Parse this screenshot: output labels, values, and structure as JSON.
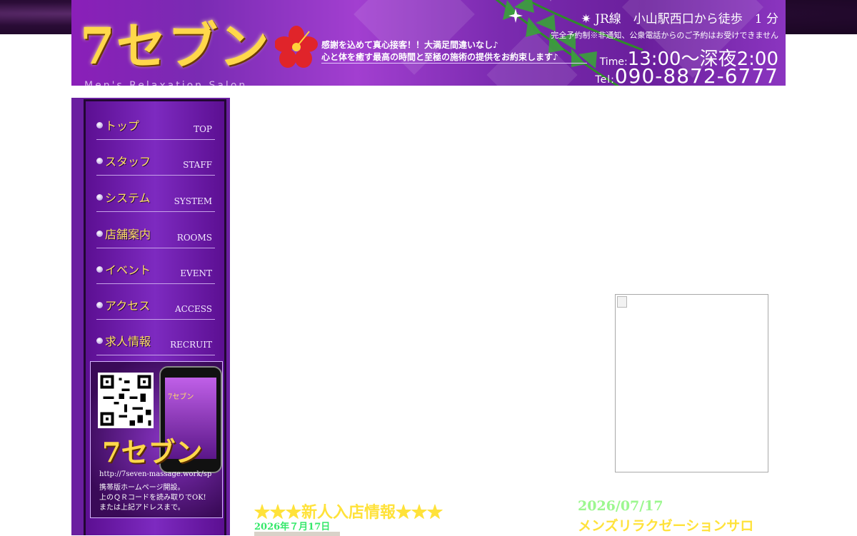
{
  "header": {
    "logo": "7セブン",
    "logo_sub": "Men's Relaxation Salon",
    "tagline1": "感謝を込めて真心接客！！大満足間違いなし♪",
    "tagline2": "心と体を癒す最高の時間と至極の施術の提供をお約束します♪",
    "access": "JR線　小山駅西口から徒歩　1 分",
    "reservation_note": "完全予約制※非通知、公衆電話からのご予約はお受けできません",
    "time_label": "Time:",
    "hours": "13:00～深夜2:00",
    "tel_label": "Tel:",
    "tel": "090-8872-6777"
  },
  "sidebar": {
    "nav": [
      {
        "jp": "トップ",
        "en": "TOP"
      },
      {
        "jp": "スタッフ",
        "en": "STAFF"
      },
      {
        "jp": "システム",
        "en": "SYSTEM"
      },
      {
        "jp": "店舗案内",
        "en": "ROOMS"
      },
      {
        "jp": "イベント",
        "en": "EVENT"
      },
      {
        "jp": "アクセス",
        "en": "ACCESS"
      },
      {
        "jp": "求人情報",
        "en": "RECRUIT"
      }
    ],
    "mobile": {
      "phone_logo": "7セブン",
      "logo": "7セブン",
      "url": "http://7seven-massage.work/sp",
      "line1": "携帯版ホームページ開設。",
      "line2": "上のＱＲコードを読み取りでOK!",
      "line3": "または上記アドレスまで。"
    }
  },
  "news": {
    "title": "★★★新人入店情報★★★",
    "date": "2026年７月17日"
  },
  "blog": {
    "date": "2026/07/17",
    "title": "メンズリラクゼーションサロ"
  },
  "colors": {
    "header_purple": "#8a1fb8",
    "sidebar_purple": "#6a1fa0",
    "logo_gold": "#ffd84a",
    "news_yellow": "#ffe23a",
    "date_green": "#35e86a"
  }
}
